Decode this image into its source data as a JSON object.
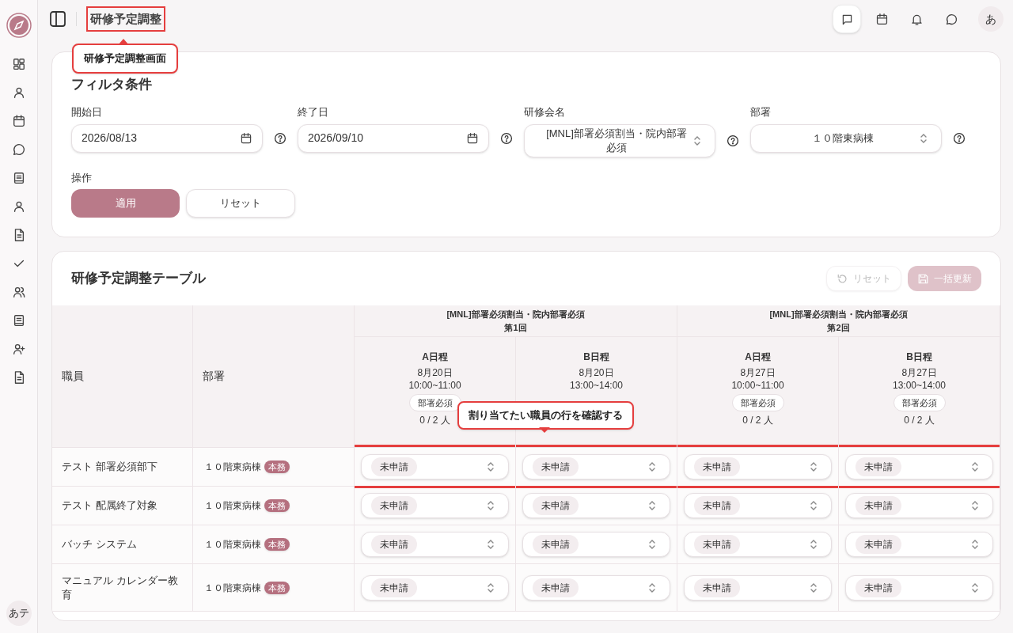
{
  "sidebar": {
    "items": [
      {
        "kind": "grid"
      },
      {
        "kind": "user"
      },
      {
        "kind": "calendar"
      },
      {
        "kind": "chat"
      },
      {
        "kind": "book"
      },
      {
        "kind": "user"
      },
      {
        "kind": "file"
      },
      {
        "kind": "check"
      },
      {
        "kind": "users"
      },
      {
        "kind": "book"
      },
      {
        "kind": "user-plus"
      },
      {
        "kind": "file"
      }
    ],
    "avatar": "あテ"
  },
  "header": {
    "title": "研修予定調整",
    "actions": [
      {
        "kind": "message",
        "selected": true
      },
      {
        "kind": "calendar",
        "selected": false
      },
      {
        "kind": "bell",
        "selected": false
      },
      {
        "kind": "chat",
        "selected": false
      }
    ],
    "avatar": "あ"
  },
  "tour": {
    "title_hint": "研修予定調整画面",
    "row_hint": "割り当てたい職員の行を確認する"
  },
  "filter": {
    "title": "フィルタ条件",
    "fields": [
      {
        "label": "開始日",
        "kind": "date",
        "value": "2026/08/13"
      },
      {
        "label": "終了日",
        "kind": "date",
        "value": "2026/09/10"
      },
      {
        "label": "研修会名",
        "kind": "select",
        "value": "[MNL]部署必須割当・院内部署必須"
      },
      {
        "label": "部署",
        "kind": "select",
        "value": "１０階東病棟"
      }
    ],
    "actions_label": "操作",
    "buttons": [
      {
        "label": "適用",
        "kind": "primary"
      },
      {
        "label": "リセット",
        "kind": "secondary"
      }
    ]
  },
  "table": {
    "title": "研修予定調整テーブル",
    "toolbar": [
      {
        "label": "リセット",
        "kind": "reset",
        "disabled": true
      },
      {
        "label": "一括更新",
        "kind": "save",
        "disabled": true
      }
    ],
    "columns": {
      "staff": "職員",
      "department": "部署"
    },
    "sessions": [
      {
        "course": "[MNL]部署必須割当・院内部署必須",
        "round": "第1回",
        "slots": [
          {
            "name": "A日程",
            "date": "8月20日",
            "time": "10:00~11:00",
            "tag": "部署必須",
            "count": "0 / 2 人"
          },
          {
            "name": "B日程",
            "date": "8月20日",
            "time": "13:00~14:00"
          }
        ]
      },
      {
        "course": "[MNL]部署必須割当・院内部署必須",
        "round": "第2回",
        "slots": [
          {
            "name": "A日程",
            "date": "8月27日",
            "time": "10:00~11:00",
            "tag": "部署必須",
            "count": "0 / 2 人"
          },
          {
            "name": "B日程",
            "date": "8月27日",
            "time": "13:00~14:00",
            "tag": "部署必須",
            "count": "0 / 2 人"
          }
        ]
      }
    ],
    "rows": [
      {
        "name": "テスト 部署必須部下",
        "department": "１０階東病棟",
        "badge": "本務",
        "highlighted": true,
        "cells": [
          "未申請",
          "未申請",
          "未申請",
          "未申請"
        ]
      },
      {
        "name": "テスト 配属終了対象",
        "department": "１０階東病棟",
        "badge": "本務",
        "highlighted": false,
        "cells": [
          "未申請",
          "未申請",
          "未申請",
          "未申請"
        ]
      },
      {
        "name": "バッチ システム",
        "department": "１０階東病棟",
        "badge": "本務",
        "highlighted": false,
        "cells": [
          "未申請",
          "未申請",
          "未申請",
          "未申請"
        ]
      },
      {
        "name": "マニュアル カレンダー教育",
        "department": "１０階東病棟",
        "badge": "本務",
        "highlighted": false,
        "cells": [
          "未申請",
          "未申請",
          "未申請",
          "未申請"
        ]
      }
    ]
  }
}
